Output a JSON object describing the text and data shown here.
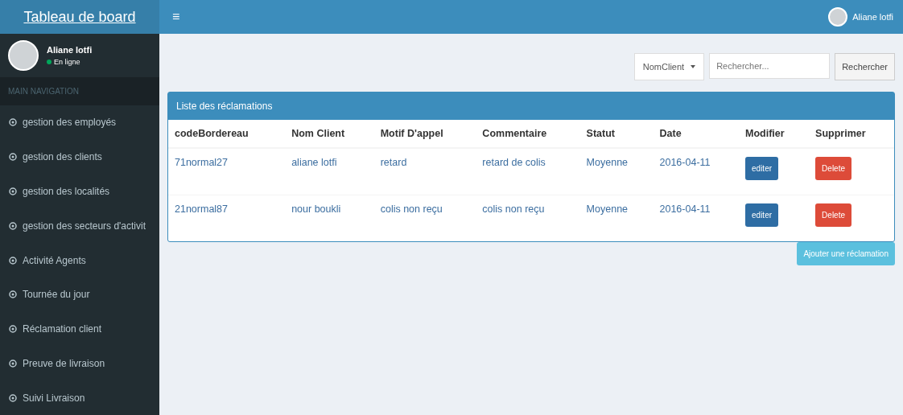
{
  "brand": "Tableau de board",
  "menu_toggle": "≡",
  "top_user": "Aliane lotfi",
  "sidebar": {
    "user": {
      "name": "Aliane lotfi",
      "status": "En ligne",
      "online": true
    },
    "header": "MAIN NAVIGATION",
    "items": [
      {
        "label": "gestion des employés",
        "selected": false
      },
      {
        "label": "gestion des clients",
        "selected": false
      },
      {
        "label": "gestion des localités",
        "selected": false
      },
      {
        "label": "gestion des secteurs d'activit",
        "selected": false
      },
      {
        "label": "Activité Agents",
        "selected": false
      },
      {
        "label": "Tournée du jour",
        "selected": false
      },
      {
        "label": "Réclamation client",
        "selected": false
      },
      {
        "label": "Preuve de livraison",
        "selected": false
      },
      {
        "label": "Suivi Livraison",
        "selected": false
      }
    ]
  },
  "search": {
    "filter": "NomClient",
    "placeholder": "Rechercher...",
    "button": "Rechercher"
  },
  "panel": {
    "title": "Liste des réclamations",
    "columns": [
      "codeBordereau",
      "Nom Client",
      "Motif D'appel",
      "Commentaire",
      "Statut",
      "Date",
      "Modifier",
      "Supprimer"
    ],
    "rows": [
      {
        "cells": [
          "71normal27",
          "aliane lotfi",
          "retard",
          "retard de colis",
          "Moyenne",
          "2016-04-11"
        ],
        "edit": "editer",
        "delete": "Delete"
      },
      {
        "cells": [
          "21normal87",
          "nour boukli",
          "colis non reçu",
          "colis non reçu",
          "Moyenne",
          "2016-04-11"
        ],
        "edit": "editer",
        "delete": "Delete"
      }
    ]
  },
  "add_button": "Ajouter une réclamation"
}
